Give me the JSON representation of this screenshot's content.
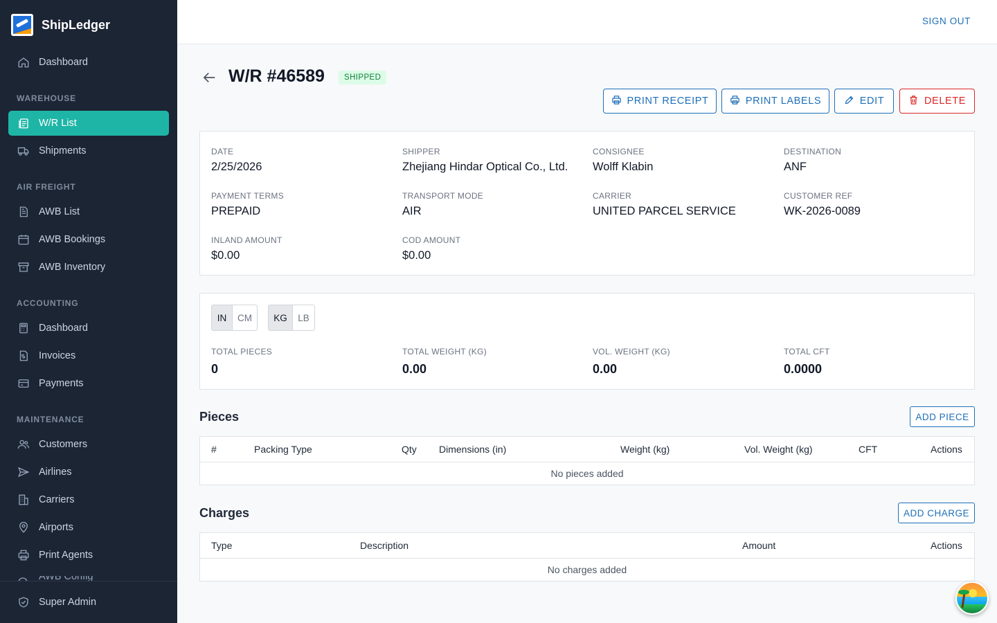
{
  "app": {
    "name": "ShipLedger"
  },
  "topbar": {
    "sign_out": "SIGN OUT"
  },
  "sidebar": {
    "dashboard": "Dashboard",
    "sections": {
      "warehouse": "WAREHOUSE",
      "air_freight": "AIR FREIGHT",
      "accounting": "ACCOUNTING",
      "maintenance": "MAINTENANCE"
    },
    "items": {
      "wr_list": "W/R List",
      "shipments": "Shipments",
      "awb_list": "AWB List",
      "awb_bookings": "AWB Bookings",
      "awb_inventory": "AWB Inventory",
      "acct_dashboard": "Dashboard",
      "invoices": "Invoices",
      "payments": "Payments",
      "customers": "Customers",
      "airlines": "Airlines",
      "carriers": "Carriers",
      "airports": "Airports",
      "print_agents": "Print Agents",
      "awb_config": "AWB Config",
      "super_admin": "Super Admin"
    },
    "active_color": "#1fb5a6"
  },
  "header": {
    "title": "W/R #46589",
    "status": "SHIPPED",
    "buttons": {
      "print_receipt": "PRINT RECEIPT",
      "print_labels": "PRINT LABELS",
      "edit": "EDIT",
      "delete": "DELETE"
    }
  },
  "details": {
    "date": {
      "label": "DATE",
      "value": "2/25/2026"
    },
    "shipper": {
      "label": "SHIPPER",
      "value": "Zhejiang Hindar Optical Co., Ltd."
    },
    "consignee": {
      "label": "CONSIGNEE",
      "value": "Wolff Klabin"
    },
    "destination": {
      "label": "DESTINATION",
      "value": "ANF"
    },
    "payment_terms": {
      "label": "PAYMENT TERMS",
      "value": "PREPAID"
    },
    "transport_mode": {
      "label": "TRANSPORT MODE",
      "value": "AIR"
    },
    "carrier": {
      "label": "CARRIER",
      "value": "UNITED PARCEL SERVICE"
    },
    "customer_ref": {
      "label": "CUSTOMER REF",
      "value": "WK-2026-0089"
    },
    "inland_amount": {
      "label": "INLAND AMOUNT",
      "value": "$0.00"
    },
    "cod_amount": {
      "label": "COD AMOUNT",
      "value": "$0.00"
    }
  },
  "totals": {
    "length_units": {
      "selected": "IN",
      "other": "CM"
    },
    "weight_units": {
      "selected": "KG",
      "other": "LB"
    },
    "total_pieces": {
      "label": "TOTAL PIECES",
      "value": "0"
    },
    "total_weight": {
      "label": "TOTAL WEIGHT (KG)",
      "value": "0.00"
    },
    "vol_weight": {
      "label": "VOL. WEIGHT (KG)",
      "value": "0.00"
    },
    "total_cft": {
      "label": "TOTAL CFT",
      "value": "0.0000"
    }
  },
  "pieces": {
    "title": "Pieces",
    "add_button": "ADD PIECE",
    "columns": [
      "#",
      "Packing Type",
      "Qty",
      "Dimensions (in)",
      "Weight (kg)",
      "Vol. Weight (kg)",
      "CFT",
      "Actions"
    ],
    "empty": "No pieces added"
  },
  "charges": {
    "title": "Charges",
    "add_button": "ADD CHARGE",
    "columns": [
      "Type",
      "Description",
      "Amount",
      "Actions"
    ],
    "empty": "No charges added"
  }
}
